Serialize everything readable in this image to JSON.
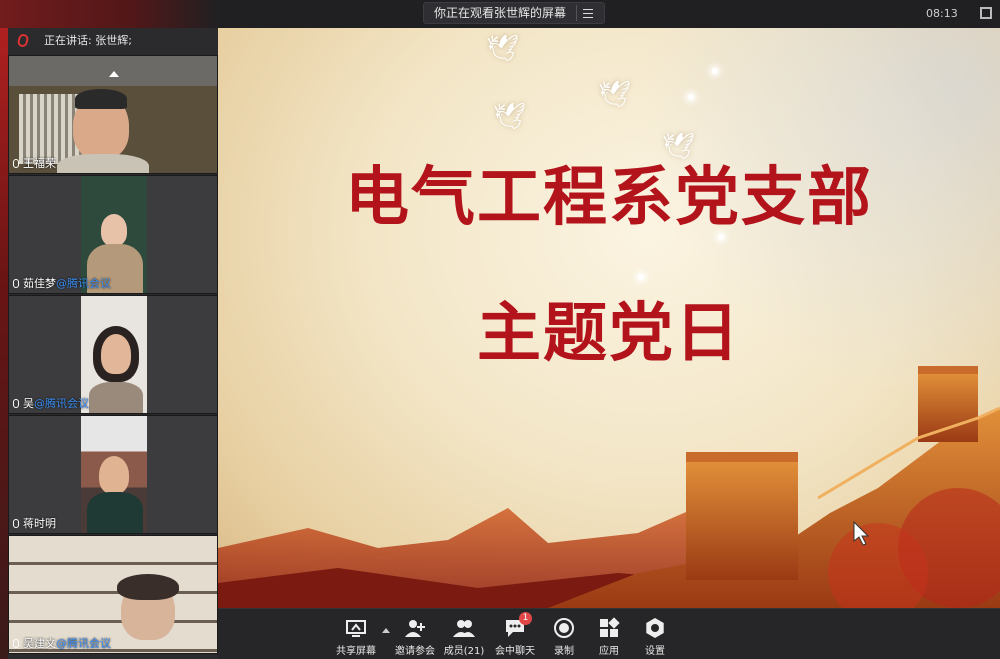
{
  "topbar": {
    "viewing_text": "你正在观看张世辉的屏幕",
    "clock": "08:13"
  },
  "sidebar": {
    "speaking_text": "正在讲话: 张世辉;",
    "participants": [
      {
        "name": "王福荣",
        "tag": ""
      },
      {
        "name": "茹佳梦",
        "tag": "@腾讯会议"
      },
      {
        "name": "吴",
        "tag": "@腾讯会议"
      },
      {
        "name": "蒋时明",
        "tag": ""
      },
      {
        "name": "吴建文",
        "tag": "@腾讯会议"
      }
    ]
  },
  "slide": {
    "title_line1": "电气工程系党支部",
    "title_line2": "主题党日"
  },
  "toolbar": {
    "share_label": "共享屏幕",
    "invite_label": "邀请参会",
    "members_label": "成员(21)",
    "chat_label": "会中聊天",
    "chat_badge": "1",
    "record_label": "录制",
    "apps_label": "应用",
    "settings_label": "设置"
  },
  "colors": {
    "slide_title": "#b3141b",
    "badge": "#e04848",
    "tag_blue": "#3b8cf0"
  }
}
